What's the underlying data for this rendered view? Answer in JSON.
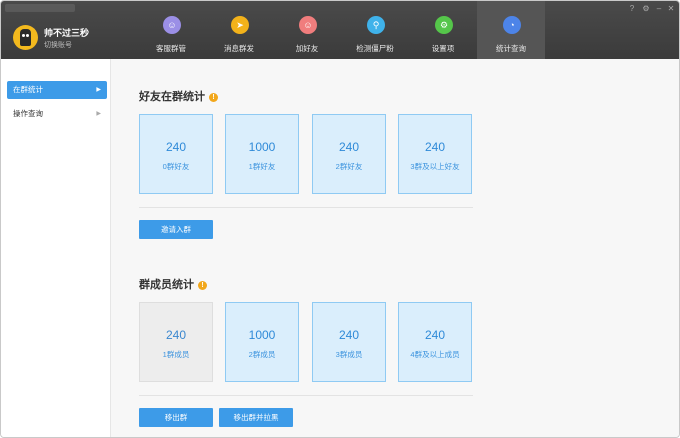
{
  "user": {
    "name": "帅不过三秒",
    "switch_label": "切换账号"
  },
  "nav": {
    "items": [
      {
        "label": "客服群管",
        "icon": "user-group-icon",
        "color": "#9b8fe6",
        "glyph": "☺"
      },
      {
        "label": "消息群发",
        "icon": "send-icon",
        "color": "#f3b21a",
        "glyph": "➤"
      },
      {
        "label": "加好友",
        "icon": "add-friend-icon",
        "color": "#f07d7d",
        "glyph": "☺"
      },
      {
        "label": "检测僵尸粉",
        "icon": "detect-icon",
        "color": "#3fb2ea",
        "glyph": "⚲"
      },
      {
        "label": "设置项",
        "icon": "gear-icon",
        "color": "#55c64a",
        "glyph": "⚙"
      },
      {
        "label": "统计查询",
        "icon": "pie-chart-icon",
        "color": "#4d84e8",
        "glyph": "◔"
      }
    ],
    "active_index": 5
  },
  "window_controls": {
    "help": "?",
    "settings": "⚙",
    "minimize": "–",
    "close": "✕"
  },
  "sidebar": {
    "items": [
      {
        "label": "在群统计",
        "active": true
      },
      {
        "label": "操作查询",
        "active": false
      }
    ]
  },
  "friends_section": {
    "title": "好友在群统计",
    "cards": [
      {
        "value": "240",
        "label": "0群好友"
      },
      {
        "value": "1000",
        "label": "1群好友"
      },
      {
        "value": "240",
        "label": "2群好友"
      },
      {
        "value": "240",
        "label": "3群及以上好友"
      }
    ],
    "invite_button": "邀请入群"
  },
  "members_section": {
    "title": "群成员统计",
    "cards": [
      {
        "value": "240",
        "label": "1群成员"
      },
      {
        "value": "1000",
        "label": "2群成员"
      },
      {
        "value": "240",
        "label": "3群成员"
      },
      {
        "value": "240",
        "label": "4群及以上成员"
      }
    ],
    "remove_button": "移出群",
    "remove_block_button": "移出群并拉黑"
  },
  "colors": {
    "accent": "#3d9be8",
    "card_bg": "#daeefc",
    "card_border": "#8fcaf3",
    "help": "#f2a71b"
  }
}
